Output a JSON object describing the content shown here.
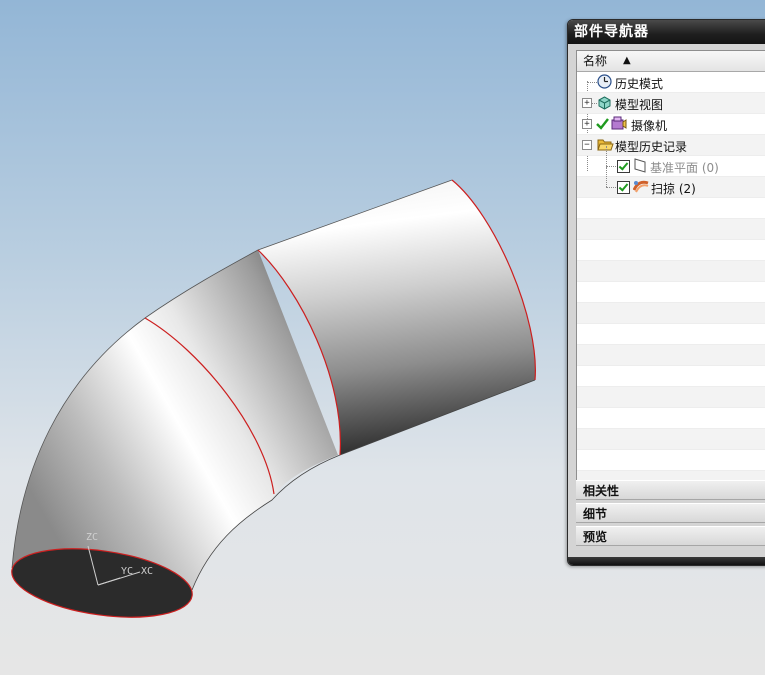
{
  "navigator": {
    "title": "部件导航器",
    "column_header": "名称",
    "sort_indicator": "▲",
    "tree": [
      {
        "label": "历史模式",
        "icon": "clock-icon",
        "expandable": false,
        "checked": false,
        "dimmed": false
      },
      {
        "label": "模型视图",
        "icon": "model-view-icon",
        "expandable": true,
        "expander": "+",
        "checked": false,
        "dimmed": false
      },
      {
        "label": "摄像机",
        "icon": "camera-icon",
        "expandable": true,
        "expander": "+",
        "checkmark": "green-check-icon",
        "dimmed": false
      },
      {
        "label": "模型历史记录",
        "icon": "folder-open-icon",
        "expandable": true,
        "expander": "−",
        "dimmed": false
      },
      {
        "label": "基准平面 (0)",
        "icon": "datum-plane-icon",
        "checked": true,
        "dimmed": true
      },
      {
        "label": "扫掠 (2)",
        "icon": "sweep-icon",
        "checked": true,
        "dimmed": false
      }
    ],
    "sections": [
      {
        "label": "相关性"
      },
      {
        "label": "细节"
      },
      {
        "label": "预览"
      }
    ]
  },
  "viewport": {
    "axis_labels": {
      "y": "YC",
      "x": "XC",
      "z": "ZC"
    },
    "edge_color": "#cc1f1f",
    "background_top": "#93b6d6",
    "background_bottom": "#e6e6e6"
  }
}
